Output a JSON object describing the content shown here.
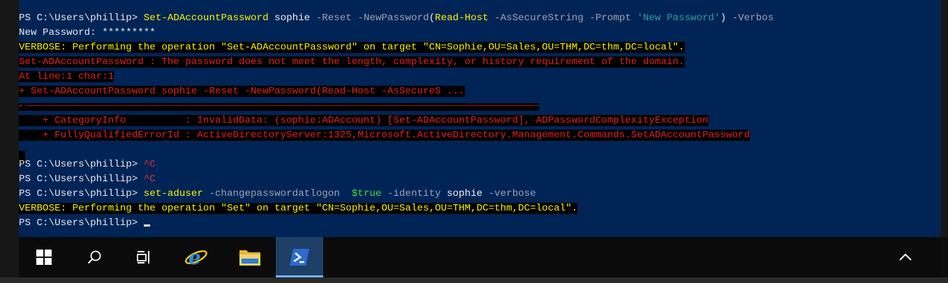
{
  "console": {
    "lines": {
      "l1": {
        "prompt": "PS C:\\Users\\phillip> ",
        "cmd": "Set-ADAccountPassword",
        "arg": " sophie ",
        "p1": "-Reset",
        "p2": " -NewPassword",
        "paren_open": "(",
        "cmd2": "Read-Host",
        "p3": " -AsSecureString",
        "p4": " -Prompt ",
        "str": "'New Password'",
        "paren_close": ")",
        "p5": " -Verbos"
      },
      "l2": {
        "text": "New Password: *********"
      },
      "l3": {
        "text": "VERBOSE: Performing the operation \"Set-ADAccountPassword\" on target \"CN=Sophie,OU=Sales,OU=THM,DC=thm,DC=local\"."
      },
      "l4": {
        "text": "Set-ADAccountPassword : The password does not meet the length, complexity, or history requirement of the domain."
      },
      "l5": {
        "text": "At line:1 char:1"
      },
      "l6": {
        "text": "+ Set-ADAccountPassword sophie -Reset -NewPassword(Read-Host -AsSecureS ..."
      },
      "l7": {
        "text": "+ ~~~~~~~~~~~~~~~~~~~~~~~~~~~~~~~~~~~~~~~~~~~~~~~~~~~~~~~~~~~~~~~~~~~~~~~~~~~~~~~~~~~~~~~~~~~~~~~~~~~~~~~~~~~~~~~~~~~~~~~~~~~~~~~~~~~~~~~~~~~~~~~~~~~~~~~~~~~~~~~~~~~~~~~~~~~~~~~~~~~~~~~~~~~~~~~~~"
      },
      "l8": {
        "text": "    + CategoryInfo          : InvalidData: (sophie:ADAccount) [Set-ADAccountPassword], ADPasswordComplexityException"
      },
      "l9": {
        "text": "    + FullyQualifiedErrorId : ActiveDirectoryServer:1325,Microsoft.ActiveDirectory.Management.Commands.SetADAccountPassword"
      },
      "l10": {
        "prompt": "PS C:\\Users\\phillip> ",
        "ctrl": "^C"
      },
      "l11": {
        "prompt": "PS C:\\Users\\phillip> ",
        "ctrl": "^C"
      },
      "l12": {
        "prompt": "PS C:\\Users\\phillip> ",
        "cmd": "set-aduser",
        "p1": " -changepasswordatlogon ",
        "var": " $true",
        "p2": " -identity",
        "arg": " sophie",
        "p3": " -verbose"
      },
      "l13": {
        "text": "VERBOSE: Performing the operation \"Set\" on target \"CN=Sophie,OU=Sales,OU=THM,DC=thm,DC=local\"."
      },
      "l14": {
        "prompt": "PS C:\\Users\\phillip> "
      }
    }
  },
  "taskbar": {
    "buttons": [
      {
        "id": "start",
        "icon": "windows-logo-icon"
      },
      {
        "id": "search",
        "icon": "search-icon"
      },
      {
        "id": "task-view",
        "icon": "task-view-icon"
      },
      {
        "id": "ie",
        "icon": "internet-explorer-icon"
      },
      {
        "id": "explorer",
        "icon": "file-explorer-icon"
      },
      {
        "id": "powershell",
        "icon": "powershell-icon",
        "active": true
      }
    ],
    "tray": {
      "icon": "chevron-up-icon"
    }
  },
  "colors": {
    "console_bg": "#012456",
    "verbose": "#f5f500",
    "error": "#e21f1f",
    "cmdlet": "#f5f500",
    "parameter": "#9aa4b1",
    "string": "#2aa198",
    "variable": "#3ddc3d",
    "taskbar_bg": "#0b0b0b",
    "taskbar_active": "#1e3f66"
  }
}
